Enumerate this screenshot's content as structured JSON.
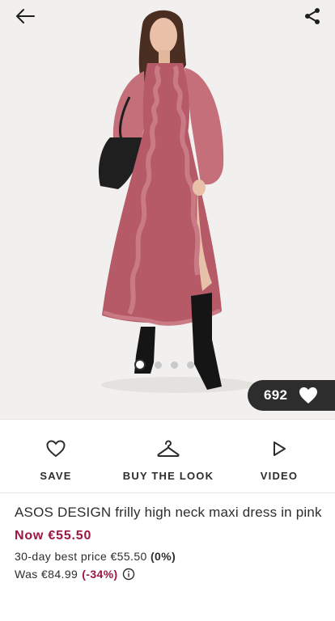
{
  "hero": {
    "image_alt": "Model wearing pink frilly high neck maxi dress with black boots and bag",
    "dots": {
      "count": 4,
      "active": 0
    },
    "likes": {
      "count": "692"
    }
  },
  "actions": {
    "save": "SAVE",
    "buy_the_look": "BUY THE LOOK",
    "video": "VIDEO"
  },
  "product": {
    "title": "ASOS DESIGN frilly high neck maxi dress in pink",
    "now_price": "Now €55.50",
    "best_price_text": "30-day best price €55.50",
    "best_price_pct": "(0%)",
    "was_text": "Was €84.99",
    "was_discount": "(-34%)"
  },
  "colors": {
    "sale": "#9b1740",
    "text": "#2d2d2d",
    "dress": "#b55a66"
  }
}
